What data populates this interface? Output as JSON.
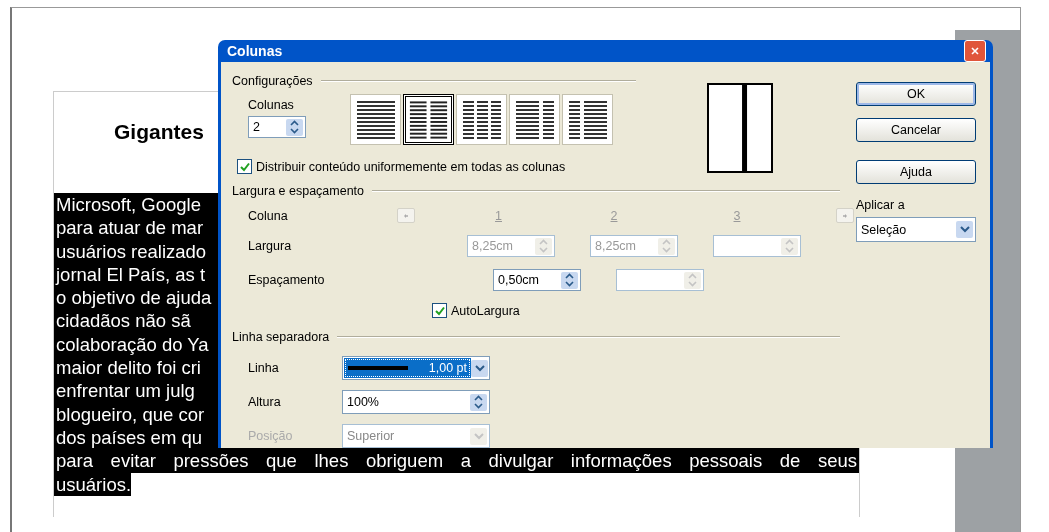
{
  "document": {
    "title": "Gigantes",
    "lines": [
      "Microsoft, Google",
      "para atuar de mar",
      "usuários realizado",
      "jornal El País, as t",
      "o objetivo de ajuda",
      "cidadãos não sã",
      "colaboração do Ya",
      "maior delito foi cri",
      "enfrentar um julg",
      "blogueiro, que cor",
      "dos países em qu",
      "para evitar pressões que lhes obriguem a divulgar informações pessoais de seus",
      "usuários."
    ]
  },
  "dialog": {
    "title": "Colunas",
    "settings": {
      "heading": "Configurações",
      "columns_label": "Colunas",
      "columns_value": "2",
      "presets": [
        {
          "kind": "one",
          "selected": false
        },
        {
          "kind": "two",
          "selected": true
        },
        {
          "kind": "three",
          "selected": false
        },
        {
          "kind": "left-wide",
          "selected": false
        },
        {
          "kind": "right-wide",
          "selected": false
        }
      ],
      "distribute": {
        "label": "Distribuir conteúdo uniformemente em todas as colunas",
        "checked": true
      }
    },
    "width_spacing": {
      "heading": "Largura e espaçamento",
      "column_label": "Coluna",
      "column_numbers": [
        "1",
        "2",
        "3"
      ],
      "width_label": "Largura",
      "widths": [
        {
          "value": "8,25cm",
          "disabled": true
        },
        {
          "value": "8,25cm",
          "disabled": true
        },
        {
          "disabled": true
        }
      ],
      "spacing_label": "Espaçamento",
      "spacings": [
        {
          "value": "0,50cm",
          "disabled": false
        },
        {
          "disabled": true
        }
      ],
      "auto_width": {
        "label": "AutoLargura",
        "checked": true
      }
    },
    "separator": {
      "heading": "Linha separadora",
      "line_label": "Linha",
      "line_value": "1,00 pt",
      "height_label": "Altura",
      "height_value": "100%",
      "position_label": "Posição",
      "position_value": "Superior",
      "position_disabled": true
    },
    "buttons": [
      {
        "label": "OK",
        "default": true
      },
      {
        "label": "Cancelar",
        "default": false
      },
      {
        "label": "Ajuda",
        "default": false
      }
    ],
    "apply_to": {
      "label": "Aplicar a",
      "value": "Seleção"
    }
  }
}
